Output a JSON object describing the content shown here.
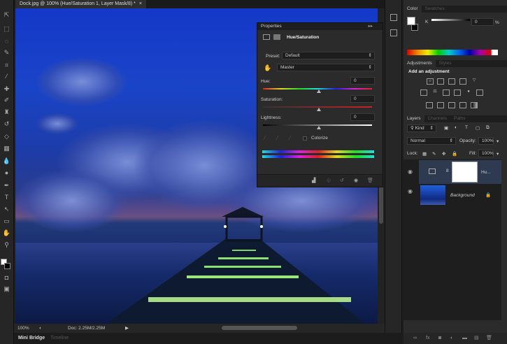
{
  "document_tab": {
    "title": "Dock.jpg @ 100% (Hue/Saturation 1, Layer Mask/8) *",
    "close": "×"
  },
  "toolbar": {
    "tools": [
      "move",
      "marquee",
      "lasso",
      "quick-select",
      "crop",
      "eyedropper",
      "healing",
      "brush",
      "stamp",
      "history-brush",
      "eraser",
      "gradient",
      "blur",
      "dodge",
      "pen",
      "type",
      "path-select",
      "shape",
      "hand",
      "zoom"
    ]
  },
  "status": {
    "zoom": "100%",
    "doc": "Doc: 2.25M/2.25M"
  },
  "bottom_tabs": [
    "Mini Bridge",
    "Timeline"
  ],
  "properties": {
    "tab": "Properties",
    "title": "Hue/Saturation",
    "preset_label": "Preset:",
    "preset_value": "Default",
    "channel_value": "Master",
    "hue_label": "Hue:",
    "hue_value": "0",
    "saturation_label": "Saturation:",
    "saturation_value": "0",
    "lightness_label": "Lightness:",
    "lightness_value": "0",
    "colorize_label": "Colorize"
  },
  "color_panel": {
    "tabs": [
      "Color",
      "Swatches"
    ],
    "k_label": "K",
    "k_value": "0",
    "percent": "%"
  },
  "adjustments": {
    "tabs": [
      "Adjustments",
      "Styles"
    ],
    "heading": "Add an adjustment"
  },
  "layers": {
    "tabs": [
      "Layers",
      "Channels",
      "Paths"
    ],
    "filter": "Kind",
    "blend_mode": "Normal",
    "opacity_label": "Opacity:",
    "opacity_value": "100%",
    "lock_label": "Lock:",
    "fill_label": "Fill:",
    "fill_value": "100%",
    "items": [
      {
        "name": "Hu..."
      },
      {
        "name": "Background"
      }
    ]
  }
}
